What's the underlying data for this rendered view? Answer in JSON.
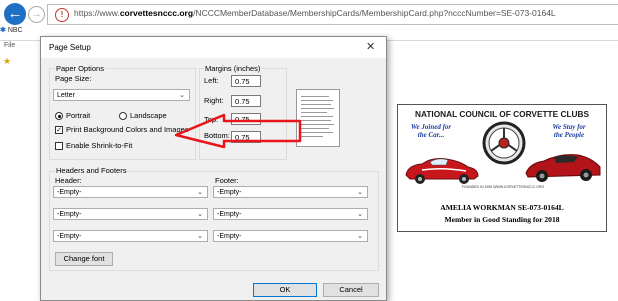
{
  "browser": {
    "url_prefix": "https://www.",
    "url_domain": "corvettesnccc.org",
    "url_path": "/NCCCMemberDatabase/MembershipCards/MembershipCard.php?ncccNumber=SE-073-0164L",
    "tab_label": "NBC",
    "menu_file": "File"
  },
  "dialog": {
    "title": "Page Setup",
    "paper_options_label": "Paper Options",
    "page_size_label": "Page Size:",
    "page_size_value": "Letter",
    "portrait_label": "Portrait",
    "landscape_label": "Landscape",
    "print_background_label": "Print Background Colors and Images",
    "print_background_checked": true,
    "shrink_to_fit_label": "Enable Shrink-to-Fit",
    "shrink_to_fit_checked": false,
    "margins_label": "Margins (inches)",
    "left_label": "Left:",
    "left_value": "0.75",
    "right_label": "Right:",
    "right_value": "0.75",
    "top_label": "Top:",
    "top_value": "0.75",
    "bottom_label": "Bottom:",
    "bottom_value": "0.75",
    "headers_footers_label": "Headers and Footers",
    "header_label": "Header:",
    "footer_label": "Footer:",
    "header_values": [
      "-Empty-",
      "-Empty-",
      "-Empty-"
    ],
    "footer_values": [
      "-Empty-",
      "-Empty-",
      "-Empty-"
    ],
    "change_font_label": "Change font",
    "ok_label": "OK",
    "cancel_label": "Cancel"
  },
  "card": {
    "title": "NATIONAL COUNCIL OF CORVETTE CLUBS",
    "slogan_left": "We Joined for the Car...",
    "slogan_right": "We Stay for the People",
    "founded": "FOUNDED IN 1959 WWW.CORVETTESNCCC.ORG",
    "member_line": "AMELIA WORKMAN  SE-073-0164L",
    "standing_line": "Member in Good Standing for 2018"
  },
  "colors": {
    "annotation_arrow": "#e8151b",
    "slogan_blue": "#1c3fa0",
    "back_button": "#1f6fc5"
  }
}
